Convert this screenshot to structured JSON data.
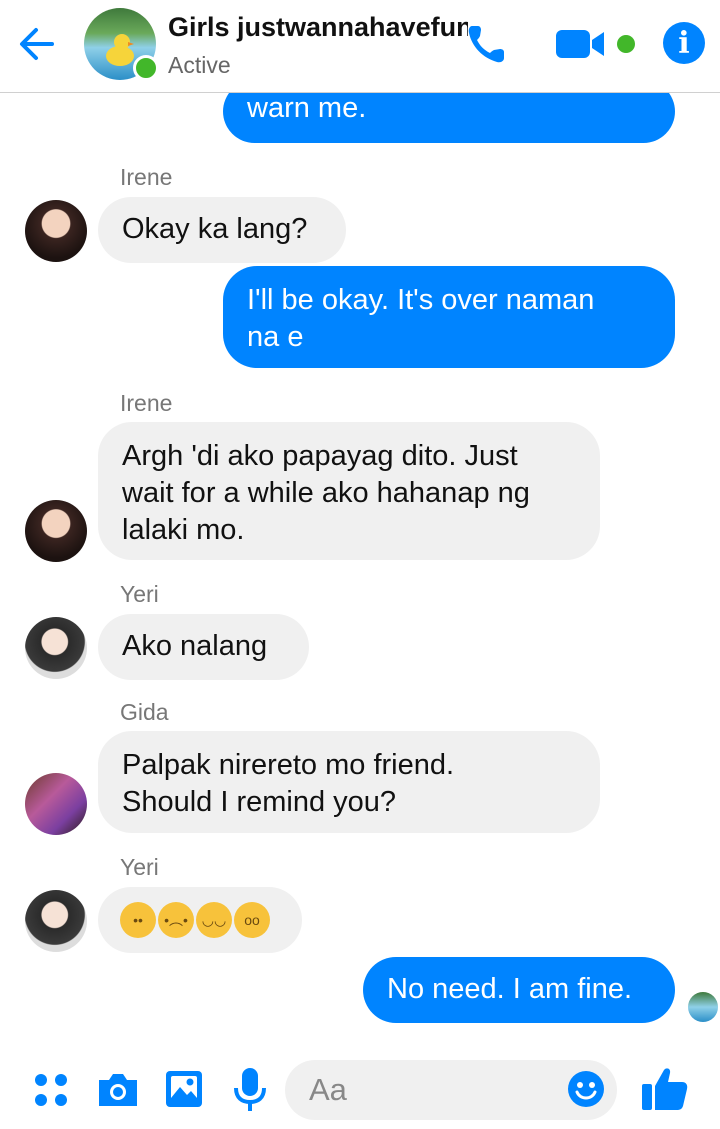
{
  "header": {
    "title": "Girls justwannahavefun",
    "status": "Active"
  },
  "colors": {
    "accent": "#0084ff",
    "active": "#42b72a",
    "incoming_bubble": "#f0f0f0"
  },
  "messages": [
    {
      "type": "outgoing",
      "text": "warn me."
    },
    {
      "type": "sender",
      "text": "Irene"
    },
    {
      "type": "incoming",
      "text": "Okay ka lang?"
    },
    {
      "type": "outgoing",
      "lines": [
        "I'll be okay. It's over naman",
        "na e"
      ]
    },
    {
      "type": "sender",
      "text": "Irene"
    },
    {
      "type": "incoming",
      "lines": [
        "Argh 'di ako papayag dito. Just",
        "wait for a while ako hahanap ng",
        "lalaki mo."
      ]
    },
    {
      "type": "sender",
      "text": "Yeri"
    },
    {
      "type": "incoming",
      "text": "Ako nalang"
    },
    {
      "type": "sender",
      "text": "Gida"
    },
    {
      "type": "incoming",
      "lines": [
        "Palpak nirereto mo friend.",
        "Should I remind you?"
      ]
    },
    {
      "type": "sender",
      "text": "Yeri"
    },
    {
      "type": "incoming_emoji",
      "emojis": [
        "rolling-eyes",
        "confused",
        "grin-tongue",
        "worried"
      ]
    },
    {
      "type": "outgoing",
      "text": "No need. I am fine."
    }
  ],
  "composer": {
    "placeholder": "Aa"
  },
  "icons": [
    "back-arrow-icon",
    "phone-icon",
    "video-icon",
    "info-icon",
    "more-apps-icon",
    "camera-icon",
    "gallery-icon",
    "microphone-icon",
    "emoji-icon",
    "like-icon"
  ]
}
